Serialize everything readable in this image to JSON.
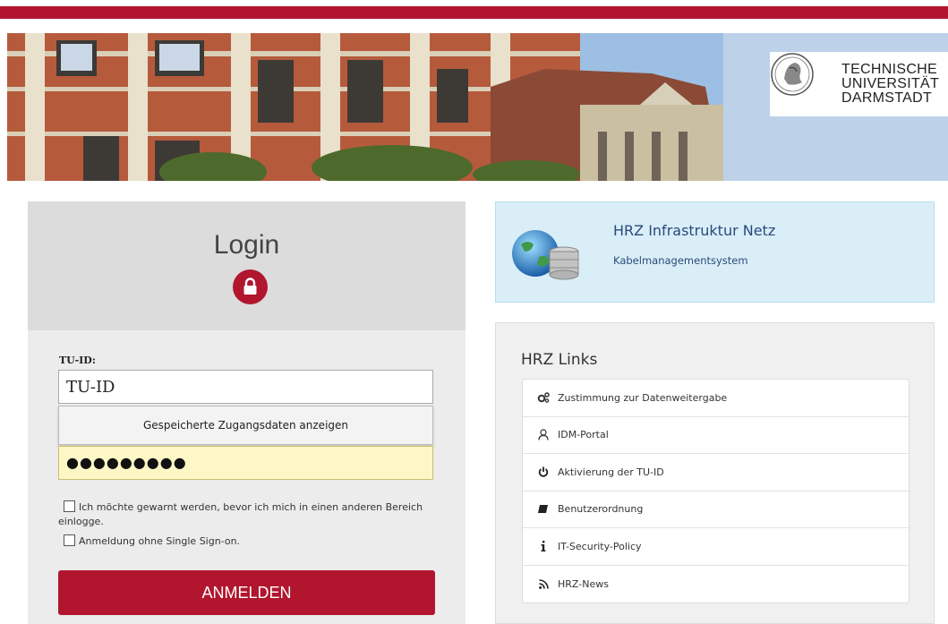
{
  "header": {
    "logo_lines": [
      "TECHNISCHE",
      "UNIVERSITÄT",
      "DARMSTADT"
    ]
  },
  "login": {
    "title": "Login",
    "tuid_label": "TU-ID:",
    "tuid_value": "TU-ID",
    "saved_credentials_label": "Gespeicherte Zugangsdaten anzeigen",
    "password_mask": "●●●●●●●●●",
    "warn_checkbox_label": "Ich möchte gewarnt werden, bevor ich mich in einen anderen Bereich einlogge.",
    "sso_checkbox_label": "Anmeldung ohne Single Sign-on.",
    "submit_label": "ANMELDEN",
    "accent_color": "#b1162e"
  },
  "infra": {
    "title": "HRZ Infrastruktur Netz",
    "subtitle": "Kabelmanagementsystem"
  },
  "links": {
    "title": "HRZ Links",
    "items": [
      {
        "icon": "gears-icon",
        "label": "Zustimmung zur Datenweitergabe"
      },
      {
        "icon": "user-icon",
        "label": "IDM-Portal"
      },
      {
        "icon": "power-icon",
        "label": "Aktivierung der TU-ID"
      },
      {
        "icon": "book-icon",
        "label": "Benutzerordnung"
      },
      {
        "icon": "info-icon",
        "label": "IT-Security-Policy"
      },
      {
        "icon": "rss-icon",
        "label": "HRZ-News"
      }
    ]
  }
}
